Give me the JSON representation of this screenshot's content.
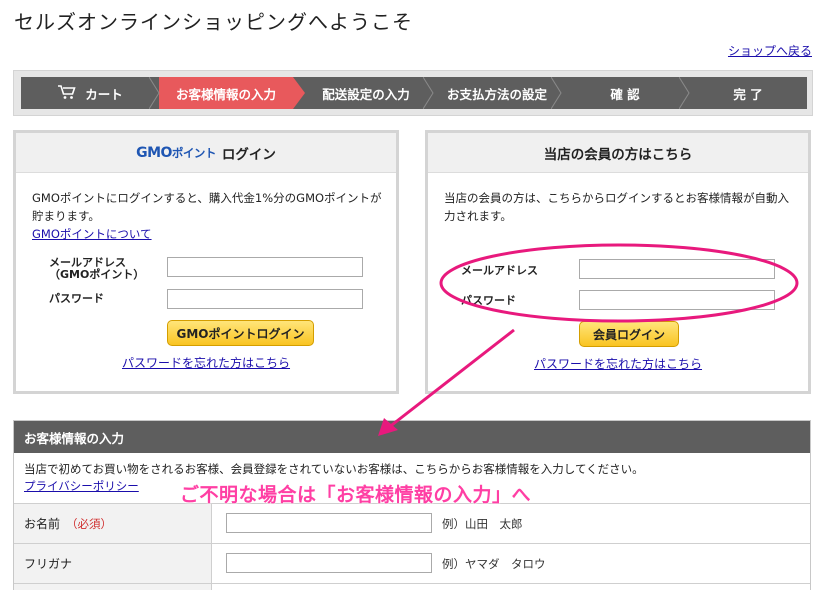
{
  "header": {
    "title": "セルズオンラインショッピングへようこそ",
    "back_link": "ショップへ戻る"
  },
  "steps": [
    {
      "label": "カート",
      "icon": "cart-icon",
      "active": false
    },
    {
      "label": "お客様情報の入力",
      "active": true
    },
    {
      "label": "配送設定の入力",
      "active": false
    },
    {
      "label": "お支払方法の設定",
      "active": false
    },
    {
      "label": "確 認",
      "active": false
    },
    {
      "label": "完 了",
      "active": false
    }
  ],
  "gmo_panel": {
    "logo_text": "GMO",
    "logo_sub": "ポイント",
    "title": "ログイン",
    "description": "GMOポイントにログインすると、購入代金1%分のGMOポイントが貯まります。",
    "about_link": "GMOポイントについて",
    "email_label": "メールアドレス（GMOポイント）",
    "password_label": "パスワード",
    "login_button": "GMOポイントログイン",
    "forgot_link": "パスワードを忘れた方はこちら"
  },
  "member_panel": {
    "title": "当店の会員の方はこちら",
    "description": "当店の会員の方は、こちらからログインするとお客様情報が自動入力されます。",
    "email_label": "メールアドレス",
    "password_label": "パスワード",
    "login_button": "会員ログイン",
    "forgot_link": "パスワードを忘れた方はこちら"
  },
  "customer_section": {
    "title": "お客様情報の入力",
    "description": "当店で初めてお買い物をされるお客様、会員登録をされていないお客様は、こちらからお客様情報を入力してください。",
    "privacy_link": "プライバシーポリシー",
    "rows": [
      {
        "label": "お名前",
        "required": "（必須）",
        "example": "例）山田　太郎"
      },
      {
        "label": "フリガナ",
        "required": "",
        "example": "例）ヤマダ　タロウ"
      }
    ]
  },
  "annotation": {
    "text": "ご不明な場合は「お客様情報の入力」へ",
    "color": "#ff3fa4"
  },
  "colors": {
    "active_step": "#e8595c",
    "step_bar": "#5e5e5e",
    "button_yellow": "#f9c422",
    "link": "#1a0dab"
  }
}
